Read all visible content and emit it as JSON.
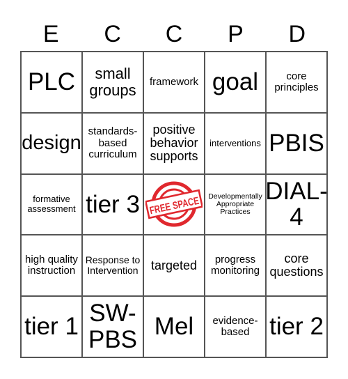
{
  "header": {
    "letters": [
      "E",
      "C",
      "C",
      "P",
      "D"
    ]
  },
  "grid": {
    "rows": [
      [
        {
          "text": "PLC",
          "size": "xl"
        },
        {
          "text": "small groups",
          "size": "ml"
        },
        {
          "text": "framework",
          "size": "sm"
        },
        {
          "text": "goal",
          "size": "xl"
        },
        {
          "text": "core principles",
          "size": "sm"
        }
      ],
      [
        {
          "text": "design",
          "size": "lg"
        },
        {
          "text": "standards-based curriculum",
          "size": "sm"
        },
        {
          "text": "positive behavior supports",
          "size": "md"
        },
        {
          "text": "interventions",
          "size": "xxs"
        },
        {
          "text": "PBIS",
          "size": "xl"
        }
      ],
      [
        {
          "text": "formative assessment",
          "size": "xxs"
        },
        {
          "text": "tier 3",
          "size": "xl"
        },
        {
          "text": "FREE SPACE",
          "size": "free"
        },
        {
          "text": "Developmentally Appropriate Practices",
          "size": "tiny"
        },
        {
          "text": "DIAL-4",
          "size": "xl"
        }
      ],
      [
        {
          "text": "high quality instruction",
          "size": "sm"
        },
        {
          "text": "Response to Intervention",
          "size": "xs"
        },
        {
          "text": "targeted",
          "size": "md"
        },
        {
          "text": "progress monitoring",
          "size": "sm"
        },
        {
          "text": "core questions",
          "size": "md"
        }
      ],
      [
        {
          "text": "tier 1",
          "size": "xl"
        },
        {
          "text": "SW-PBS",
          "size": "xl"
        },
        {
          "text": "Mel",
          "size": "xl"
        },
        {
          "text": "evidence-based",
          "size": "sm"
        },
        {
          "text": "tier 2",
          "size": "xl"
        }
      ]
    ]
  },
  "free_space": {
    "label": "FREE SPACE",
    "color": "#e0282e",
    "icon": "free-space-stamp-icon"
  }
}
